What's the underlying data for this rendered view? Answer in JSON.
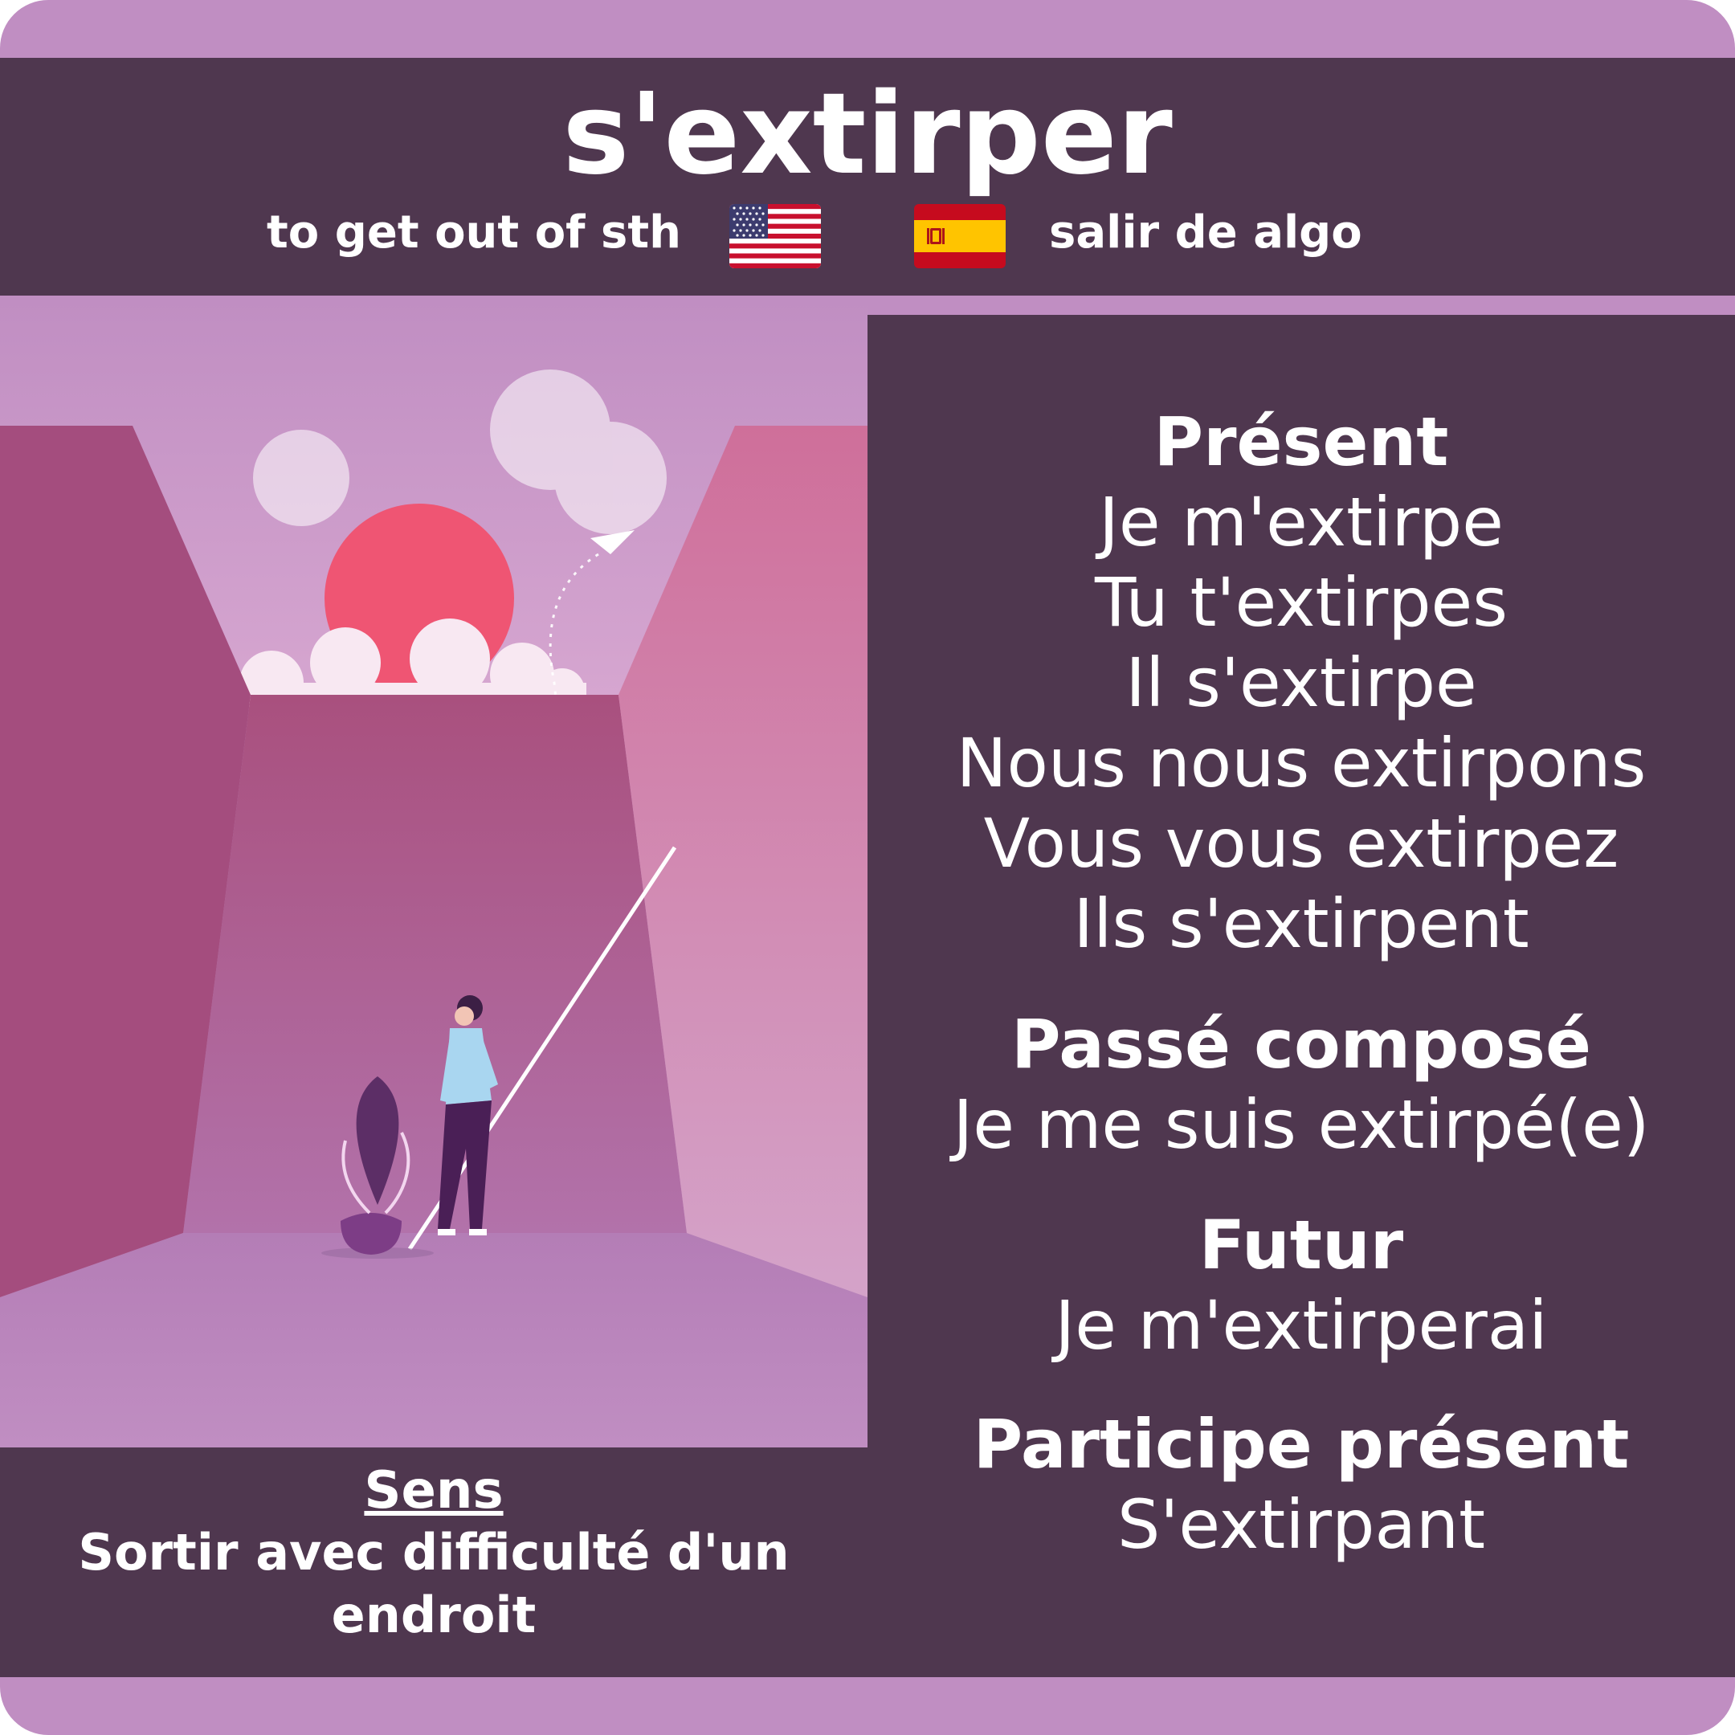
{
  "verb": "s'extirper",
  "translations": {
    "english": "to get out of sth",
    "spanish": "salir de algo"
  },
  "flags": {
    "english_icon": "us-flag-icon",
    "spanish_icon": "spain-flag-icon"
  },
  "conjugation": {
    "present": {
      "title": "Présent",
      "forms": [
        "Je m'extirpe",
        "Tu t'extirpes",
        "Il s'extirpe",
        "Nous nous extirpons",
        "Vous vous extirpez",
        "Ils s'extirpent"
      ]
    },
    "passe_compose": {
      "title": "Passé composé",
      "form": "Je me suis extirpé(e)"
    },
    "futur": {
      "title": "Futur",
      "form": "Je m'extirperai"
    },
    "participe_present": {
      "title": "Participe présent",
      "form": "S'extirpant"
    }
  },
  "meaning": {
    "label": "Sens",
    "text": "Sortir avec difficulté d'un endroit"
  },
  "colors": {
    "background": "#c08ec2",
    "panel": "#4f374f",
    "text": "#ffffff",
    "sun": "#ef5573"
  }
}
